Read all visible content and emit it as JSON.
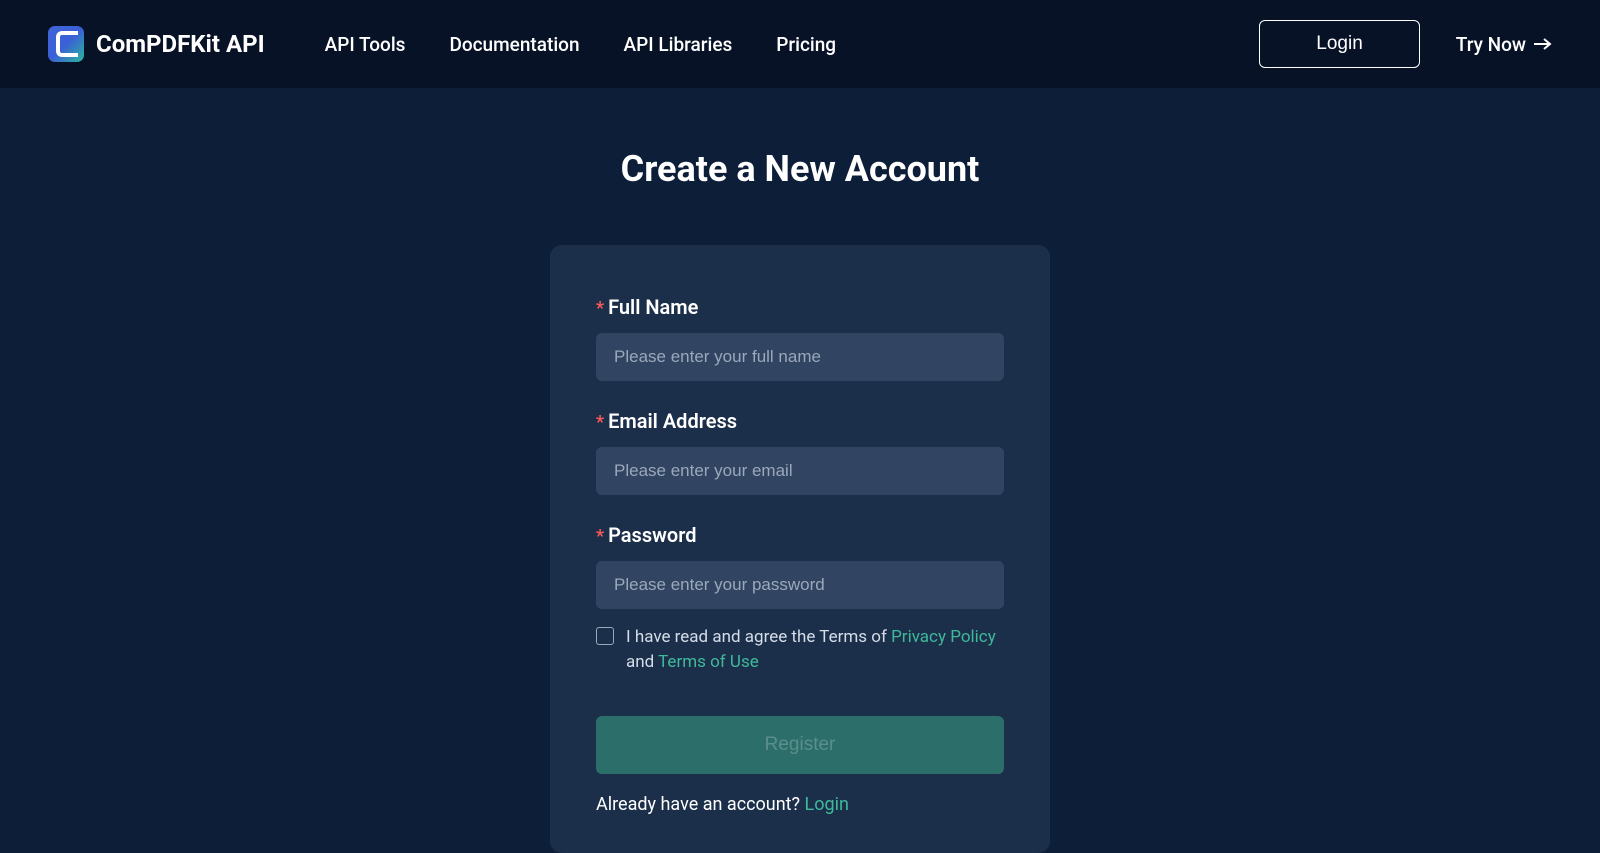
{
  "header": {
    "brand": "ComPDFKit API",
    "nav": {
      "api_tools": "API Tools",
      "documentation": "Documentation",
      "api_libraries": "API Libraries",
      "pricing": "Pricing"
    },
    "login_button": "Login",
    "try_now": "Try Now"
  },
  "page_title": "Create a New Account",
  "form": {
    "full_name": {
      "label": "Full Name",
      "placeholder": "Please enter your full name"
    },
    "email": {
      "label": "Email Address",
      "placeholder": "Please enter your email"
    },
    "password": {
      "label": "Password",
      "placeholder": "Please enter your password"
    },
    "agreement": {
      "prefix": "I have read and agree the Terms of ",
      "privacy_link": "Privacy Policy",
      "middle": " and ",
      "terms_link": "Terms of Use"
    },
    "register_button": "Register",
    "already_have": "Already have an account? ",
    "login_link": "Login"
  }
}
